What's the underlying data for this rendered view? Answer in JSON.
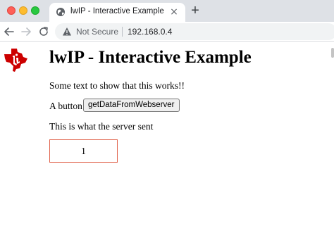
{
  "browser": {
    "tab": {
      "title": "lwIP - Interactive Example",
      "close_glyph": "×",
      "icon": "globe-icon"
    },
    "new_tab_glyph": "+",
    "address_bar": {
      "security_label": "Not Secure",
      "security_icon": "warning-icon",
      "url": "192.168.0.4"
    },
    "traffic_lights": {
      "close": "#ff5f57",
      "minimize": "#febc2e",
      "zoom": "#28c840"
    }
  },
  "page": {
    "logo": "ti-logo",
    "heading": "lwIP - Interactive Example",
    "intro_text": "Some text to show that this works!!",
    "button_row": {
      "label": "A button",
      "button_text": "getDataFromWebserver"
    },
    "server_label": "This is what the server sent",
    "server_value": "1",
    "result_border_color": "#e0614a",
    "logo_color": "#cc0000"
  }
}
